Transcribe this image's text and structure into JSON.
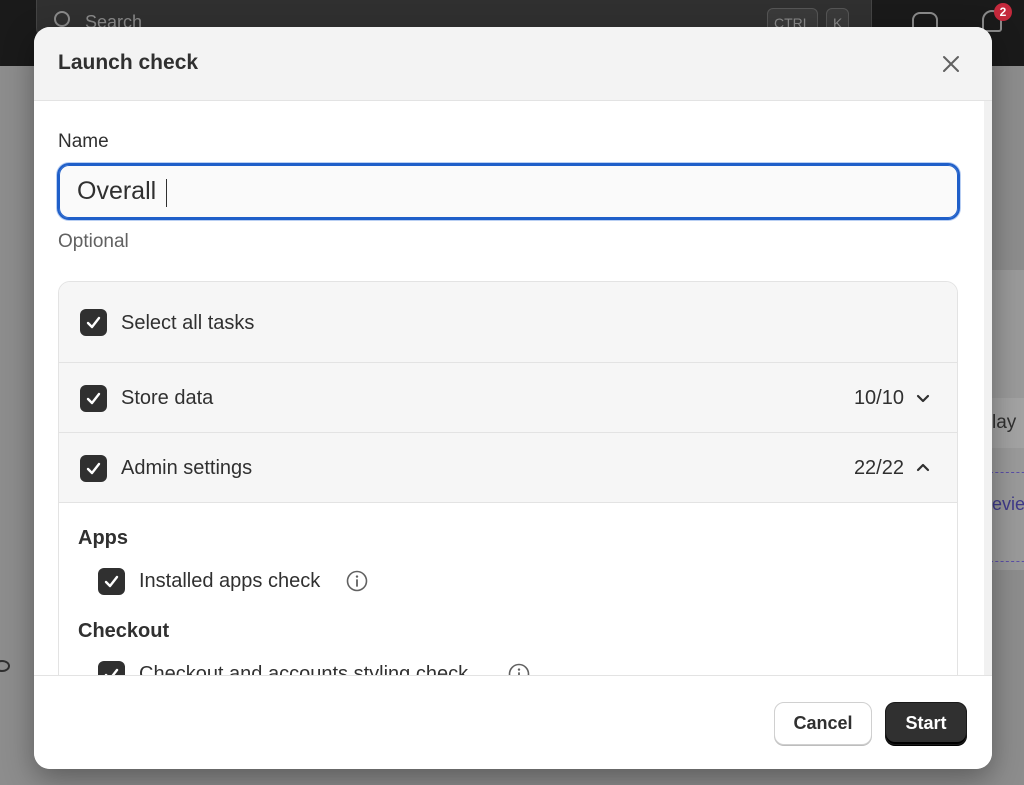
{
  "background": {
    "search_placeholder": "Search",
    "shortcut_keys": [
      "CTRL",
      "K"
    ],
    "notification_count": "2",
    "day_text": "lay",
    "review_text": "evie"
  },
  "dialog": {
    "title": "Launch check",
    "close_icon": "close-icon",
    "name_field": {
      "label": "Name",
      "value": "Overall",
      "help_text": "Optional"
    },
    "select_all": {
      "label": "Select all tasks",
      "checked": true
    },
    "groups": [
      {
        "label": "Store data",
        "count": "10/10",
        "checked": true,
        "expanded": false,
        "chevron": "chevron-down-icon"
      },
      {
        "label": "Admin settings",
        "count": "22/22",
        "checked": true,
        "expanded": true,
        "chevron": "chevron-up-icon"
      }
    ],
    "admin_sections": [
      {
        "title": "Apps",
        "items": [
          {
            "label": "Installed apps check",
            "checked": true,
            "info_icon": "info-icon"
          }
        ]
      },
      {
        "title": "Checkout",
        "items": [
          {
            "label": "Checkout and accounts styling check",
            "checked": true,
            "info_icon": "info-icon"
          }
        ]
      }
    ],
    "footer": {
      "cancel_label": "Cancel",
      "start_label": "Start"
    }
  },
  "colors": {
    "focus_ring": "#1f5fc9",
    "checkbox": "#303030",
    "primary_button": "#303030",
    "badge": "#c4293c"
  }
}
